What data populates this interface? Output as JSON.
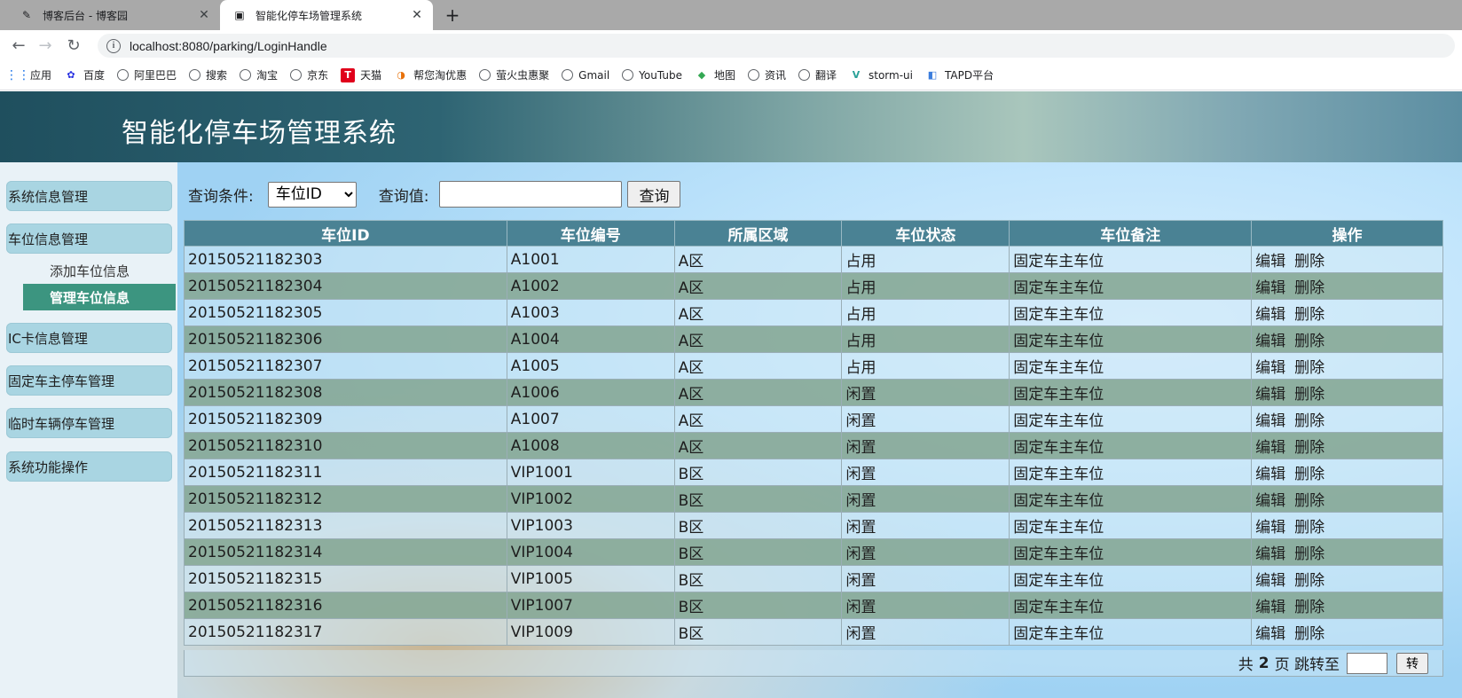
{
  "browser": {
    "tabs": [
      {
        "title": "博客后台 - 博客园",
        "active": false
      },
      {
        "title": "智能化停车场管理系统",
        "active": true
      }
    ],
    "url": "localhost:8080/parking/LoginHandle",
    "bookmarks": [
      {
        "label": "应用",
        "icon": "apps-icon"
      },
      {
        "label": "百度",
        "icon": "baidu-icon"
      },
      {
        "label": "阿里巴巴",
        "icon": "globe-icon"
      },
      {
        "label": "搜索",
        "icon": "globe-icon"
      },
      {
        "label": "淘宝",
        "icon": "globe-icon"
      },
      {
        "label": "京东",
        "icon": "globe-icon"
      },
      {
        "label": "天猫",
        "icon": "tmall-icon"
      },
      {
        "label": "帮您淘优惠",
        "icon": "bh-icon"
      },
      {
        "label": "萤火虫惠聚",
        "icon": "globe-icon"
      },
      {
        "label": "Gmail",
        "icon": "globe-icon"
      },
      {
        "label": "YouTube",
        "icon": "globe-icon"
      },
      {
        "label": "地图",
        "icon": "map-icon"
      },
      {
        "label": "资讯",
        "icon": "globe-icon"
      },
      {
        "label": "翻译",
        "icon": "globe-icon"
      },
      {
        "label": "storm-ui",
        "icon": "vue-icon"
      },
      {
        "label": "TAPD平台",
        "icon": "tapd-icon"
      }
    ]
  },
  "app": {
    "title": "智能化停车场管理系统"
  },
  "sidebar": {
    "menus": [
      "系统信息管理",
      "车位信息管理",
      "IC卡信息管理",
      "固定车主停车管理",
      "临时车辆停车管理",
      "系统功能操作"
    ],
    "sub_add": "添加车位信息",
    "sub_manage": "管理车位信息"
  },
  "search": {
    "condition_label": "查询条件:",
    "condition_value": "车位ID",
    "value_label": "查询值:",
    "value": "",
    "button": "查询"
  },
  "table": {
    "headers": [
      "车位ID",
      "车位编号",
      "所属区域",
      "车位状态",
      "车位备注",
      "操作"
    ],
    "rows": [
      [
        "20150521182303",
        "A1001",
        "A区",
        "占用",
        "固定车主车位"
      ],
      [
        "20150521182304",
        "A1002",
        "A区",
        "占用",
        "固定车主车位"
      ],
      [
        "20150521182305",
        "A1003",
        "A区",
        "占用",
        "固定车主车位"
      ],
      [
        "20150521182306",
        "A1004",
        "A区",
        "占用",
        "固定车主车位"
      ],
      [
        "20150521182307",
        "A1005",
        "A区",
        "占用",
        "固定车主车位"
      ],
      [
        "20150521182308",
        "A1006",
        "A区",
        "闲置",
        "固定车主车位"
      ],
      [
        "20150521182309",
        "A1007",
        "A区",
        "闲置",
        "固定车主车位"
      ],
      [
        "20150521182310",
        "A1008",
        "A区",
        "闲置",
        "固定车主车位"
      ],
      [
        "20150521182311",
        "VIP1001",
        "B区",
        "闲置",
        "固定车主车位"
      ],
      [
        "20150521182312",
        "VIP1002",
        "B区",
        "闲置",
        "固定车主车位"
      ],
      [
        "20150521182313",
        "VIP1003",
        "B区",
        "闲置",
        "固定车主车位"
      ],
      [
        "20150521182314",
        "VIP1004",
        "B区",
        "闲置",
        "固定车主车位"
      ],
      [
        "20150521182315",
        "VIP1005",
        "B区",
        "闲置",
        "固定车主车位"
      ],
      [
        "20150521182316",
        "VIP1007",
        "B区",
        "闲置",
        "固定车主车位"
      ],
      [
        "20150521182317",
        "VIP1009",
        "B区",
        "闲置",
        "固定车主车位"
      ]
    ],
    "edit_label": "编辑",
    "delete_label": "删除"
  },
  "pager": {
    "prefix": "共",
    "total_pages": "2",
    "suffix": "页 跳转至",
    "jump_value": "",
    "go_button": "转"
  }
}
